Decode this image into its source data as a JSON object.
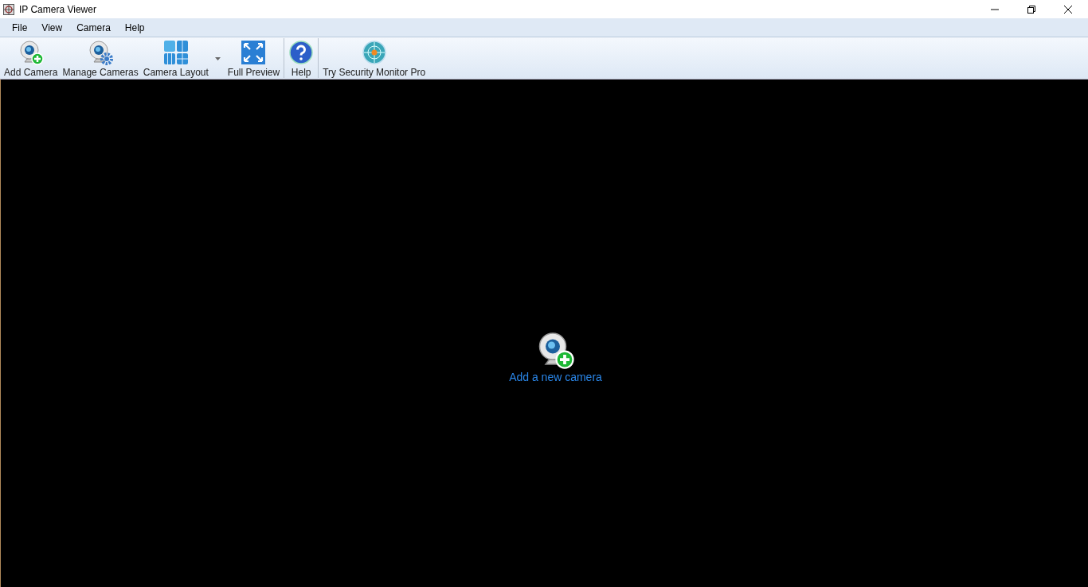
{
  "window": {
    "title": "IP Camera Viewer"
  },
  "menu": [
    "File",
    "View",
    "Camera",
    "Help"
  ],
  "toolbar": [
    {
      "label": "Add Camera",
      "kind": "add-camera",
      "dropdown": false,
      "separator_before": false
    },
    {
      "label": "Manage Cameras",
      "kind": "manage-cameras",
      "dropdown": false,
      "separator_before": false
    },
    {
      "label": "Camera Layout",
      "kind": "layout",
      "dropdown": true,
      "separator_before": false
    },
    {
      "label": "Full Preview",
      "kind": "full-preview",
      "dropdown": false,
      "separator_before": false
    },
    {
      "label": "Help",
      "kind": "help",
      "dropdown": false,
      "separator_before": true
    },
    {
      "label": "Try Security Monitor Pro",
      "kind": "target",
      "dropdown": false,
      "separator_before": true
    }
  ],
  "main": {
    "link": "Add a new camera"
  }
}
